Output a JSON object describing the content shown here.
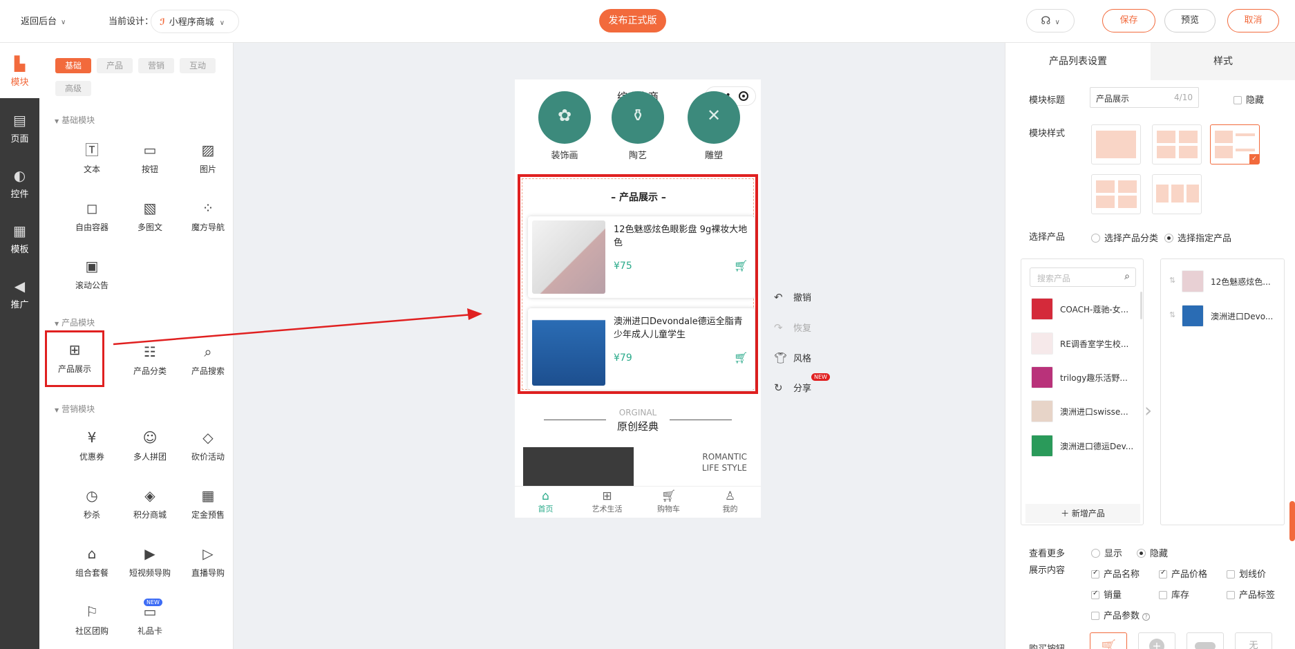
{
  "topbar": {
    "back_label": "返回后台",
    "current_design_label": "当前设计：",
    "current_design_value": "小程序商城",
    "publish_label": "发布正式版",
    "save_label": "保存",
    "preview_label": "预览",
    "cancel_label": "取消"
  },
  "sidenav": {
    "items": [
      {
        "label": "模块",
        "icon": "blocks-icon"
      },
      {
        "label": "页面",
        "icon": "page-icon"
      },
      {
        "label": "控件",
        "icon": "toggle-icon"
      },
      {
        "label": "模板",
        "icon": "template-icon"
      },
      {
        "label": "推广",
        "icon": "megaphone-icon"
      }
    ]
  },
  "module_panel": {
    "tabs": [
      "基础",
      "产品",
      "营销",
      "互动",
      "高级"
    ],
    "active_tab": "基础",
    "sections": {
      "basic": {
        "title": "基础模块",
        "items": [
          "文本",
          "按钮",
          "图片",
          "自由容器",
          "多图文",
          "魔方导航",
          "滚动公告"
        ]
      },
      "product": {
        "title": "产品模块",
        "items": [
          "产品展示",
          "产品分类",
          "产品搜索"
        ]
      },
      "marketing": {
        "title": "营销模块",
        "items": [
          "优惠券",
          "多人拼团",
          "砍价活动",
          "秒杀",
          "积分商城",
          "定金预售",
          "组合套餐",
          "短视频导购",
          "直播导购",
          "社区团购",
          "礼品卡"
        ]
      }
    },
    "new_badge": "NEW"
  },
  "phone": {
    "title": "综合电商",
    "categories": [
      "装饰画",
      "陶艺",
      "雕塑"
    ],
    "product_section_title": "产品展示",
    "products": [
      {
        "name": "12色魅惑炫色眼影盘 9g裸妆大地色",
        "price": "¥75"
      },
      {
        "name": "澳洲进口Devondale德运全脂青少年成人儿童学生",
        "price": "¥79"
      }
    ],
    "original": {
      "en": "ORGINAL",
      "cn": "原创经典"
    },
    "romantic": [
      "ROMANTIC",
      "LIFE STYLE"
    ],
    "tabbar": [
      "首页",
      "艺术生活",
      "购物车",
      "我的"
    ]
  },
  "side_actions": {
    "undo": "撤销",
    "redo": "恢复",
    "style": "风格",
    "share": "分享",
    "share_badge": "NEW"
  },
  "right_panel": {
    "tabs": [
      "产品列表设置",
      "样式"
    ],
    "module_title_label": "模块标题",
    "module_title_value": "产品展示",
    "module_title_count": "4/10",
    "hide_label": "隐藏",
    "module_style_label": "模块样式",
    "select_product_label": "选择产品",
    "select_by_category": "选择产品分类",
    "select_specific": "选择指定产品",
    "search_placeholder": "搜索产品",
    "product_list": [
      "COACH-蔻驰-女...",
      "RE调香室学生校...",
      "trilogy趣乐活野...",
      "澳洲进口swisse...",
      "澳洲进口德运Dev..."
    ],
    "add_product_label": "新增产品",
    "selected_list": [
      "12色魅惑炫色...",
      "澳洲进口Devo..."
    ],
    "view_more_label": "查看更多",
    "show_label": "显示",
    "hide_label2": "隐藏",
    "display_content_label": "展示内容",
    "display_options": [
      {
        "label": "产品名称",
        "checked": true
      },
      {
        "label": "产品价格",
        "checked": true
      },
      {
        "label": "划线价",
        "checked": false
      },
      {
        "label": "销量",
        "checked": true
      },
      {
        "label": "库存",
        "checked": false
      },
      {
        "label": "产品标签",
        "checked": false
      },
      {
        "label": "产品参数",
        "checked": false
      }
    ],
    "buy_button_label": "购买按钮",
    "buy_none_label": "无"
  },
  "colors": {
    "accent": "#f26a3c",
    "nav_bg": "#3a3a3a",
    "price": "#2aaa8a",
    "highlight": "#e02020"
  }
}
